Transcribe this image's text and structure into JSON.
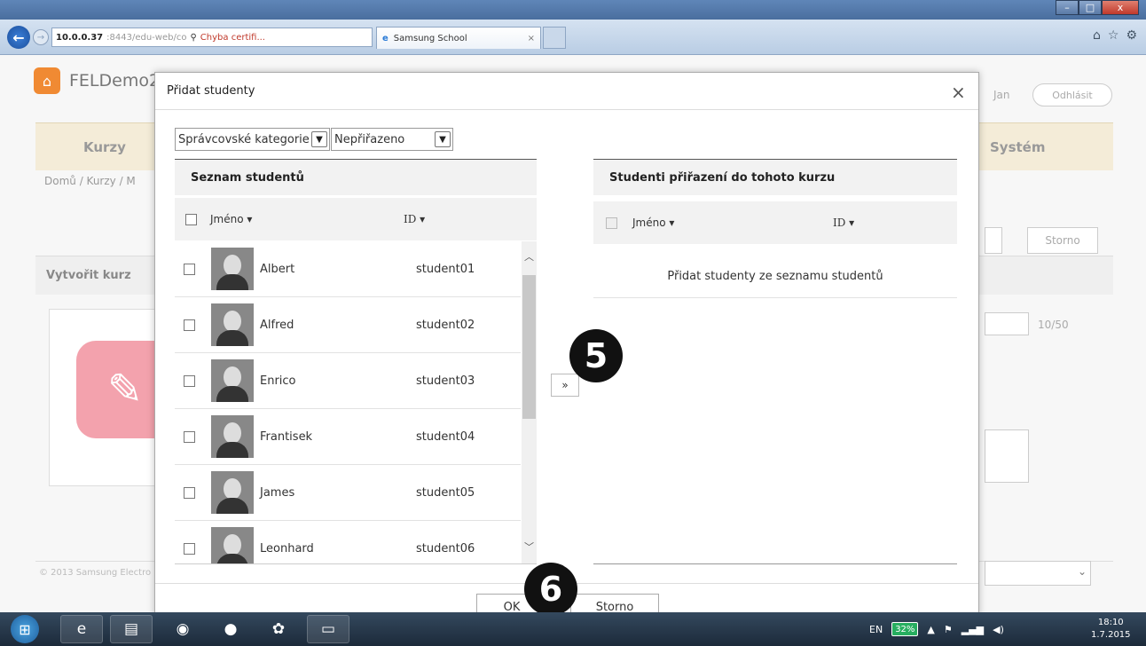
{
  "browser": {
    "address_url": "10.0.0.37",
    "address_rest": ":8443/edu-web/co",
    "cert_warning": "Chyba certifi...",
    "tab_title": "Samsung School",
    "win_min": "–",
    "win_max": "□",
    "win_close": "x"
  },
  "background": {
    "brand": "FELDemo2",
    "user": "Jan",
    "logout": "Odhlásit",
    "menu_courses": "Kurzy",
    "menu_system": "Systém",
    "breadcrumb": "Domů / Kurzy / M",
    "section_title": "Vytvořit kurz",
    "storno": "Storno",
    "counter": "10/50",
    "copyright": "© 2013 Samsung Electro"
  },
  "modal": {
    "title": "Přidat studenty",
    "close": "×",
    "filter1": "Správcovské kategorie",
    "filter2": "Nepřiřazeno",
    "left_panel_title": "Seznam studentů",
    "right_panel_title": "Studenti přiřazení do tohoto kurzu",
    "col_name": "Jméno ▾",
    "col_id": "ID ▾",
    "empty_message": "Přidat studenty ze seznamu studentů",
    "move_button": "»",
    "ok_button": "OK",
    "cancel_button": "Storno",
    "students": [
      {
        "name": "Albert",
        "id": "student01"
      },
      {
        "name": "Alfred",
        "id": "student02"
      },
      {
        "name": "Enrico",
        "id": "student03"
      },
      {
        "name": "Frantisek",
        "id": "student04"
      },
      {
        "name": "James",
        "id": "student05"
      },
      {
        "name": "Leonhard",
        "id": "student06"
      }
    ]
  },
  "annotations": {
    "step5": "5",
    "step6": "6"
  },
  "taskbar": {
    "language": "EN",
    "battery": "32%",
    "time": "18:10",
    "date": "1.7.2015"
  }
}
